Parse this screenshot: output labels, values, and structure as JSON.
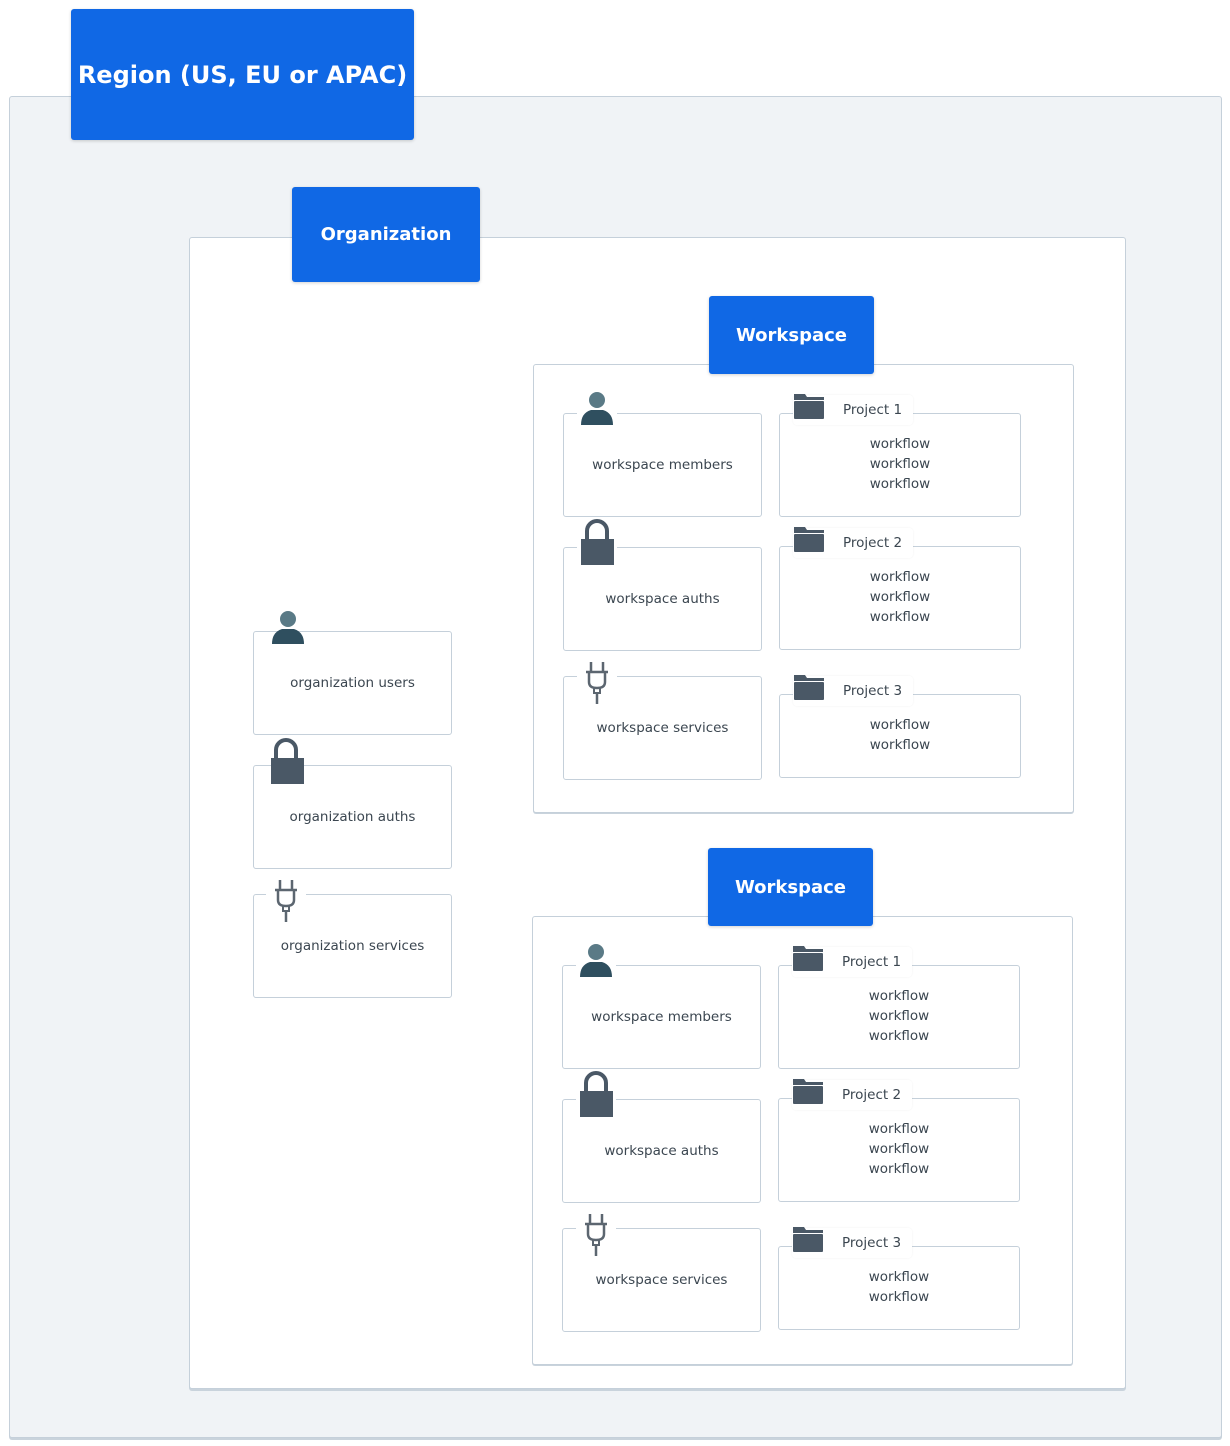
{
  "region": {
    "title": "Region (US, EU or APAC)"
  },
  "organization": {
    "title": "Organization",
    "items": [
      {
        "label": "organization users",
        "icon": "user-icon"
      },
      {
        "label": "organization auths",
        "icon": "lock-icon"
      },
      {
        "label": "organization services",
        "icon": "plug-icon"
      }
    ]
  },
  "workspaces": [
    {
      "title": "Workspace",
      "items": [
        {
          "label": "workspace members",
          "icon": "user-icon"
        },
        {
          "label": "workspace auths",
          "icon": "lock-icon"
        },
        {
          "label": "workspace services",
          "icon": "plug-icon"
        }
      ],
      "projects": [
        {
          "name": "Project 1",
          "workflows": [
            "workflow",
            "workflow",
            "workflow"
          ]
        },
        {
          "name": "Project 2",
          "workflows": [
            "workflow",
            "workflow",
            "workflow"
          ]
        },
        {
          "name": "Project 3",
          "workflows": [
            "workflow",
            "workflow"
          ]
        }
      ]
    },
    {
      "title": "Workspace",
      "items": [
        {
          "label": "workspace members",
          "icon": "user-icon"
        },
        {
          "label": "workspace auths",
          "icon": "lock-icon"
        },
        {
          "label": "workspace services",
          "icon": "plug-icon"
        }
      ],
      "projects": [
        {
          "name": "Project 1",
          "workflows": [
            "workflow",
            "workflow",
            "workflow"
          ]
        },
        {
          "name": "Project 2",
          "workflows": [
            "workflow",
            "workflow",
            "workflow"
          ]
        },
        {
          "name": "Project 3",
          "workflows": [
            "workflow",
            "workflow"
          ]
        }
      ]
    }
  ],
  "colors": {
    "accent": "#1068e5",
    "region_bg": "#f0f3f6",
    "border": "#c5d0da",
    "icon": "#4a5866"
  }
}
